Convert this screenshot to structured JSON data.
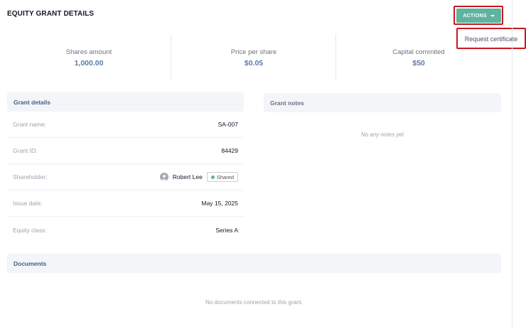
{
  "header": {
    "title": "EQUITY GRANT DETAILS",
    "actions_label": "ACTIONS",
    "dropdown_item": "Request certificate"
  },
  "stats": [
    {
      "label": "Shares amount",
      "value": "1,000.00"
    },
    {
      "label": "Price per share",
      "value": "$0.05"
    },
    {
      "label": "Capital commited",
      "value": "$50"
    }
  ],
  "grant_details": {
    "title": "Grant details",
    "rows": {
      "name": {
        "label": "Grant name:",
        "value": "SA-007"
      },
      "id": {
        "label": "Grant ID:",
        "value": "84429"
      },
      "shareholder": {
        "label": "Shareholder:",
        "name": "Robert Lee",
        "badge": "Shared"
      },
      "issue_date": {
        "label": "Issue date:",
        "value": "May 15, 2025"
      },
      "equity_class": {
        "label": "Equity class:",
        "value": "Series A"
      }
    }
  },
  "grant_notes": {
    "title": "Grant notes",
    "empty": "No any notes yet"
  },
  "documents": {
    "title": "Documents",
    "empty": "No documents connected to this grant."
  },
  "colors": {
    "accent": "#5fb3a0",
    "highlight": "#c8171e",
    "stat_value": "#5b7aa6"
  }
}
